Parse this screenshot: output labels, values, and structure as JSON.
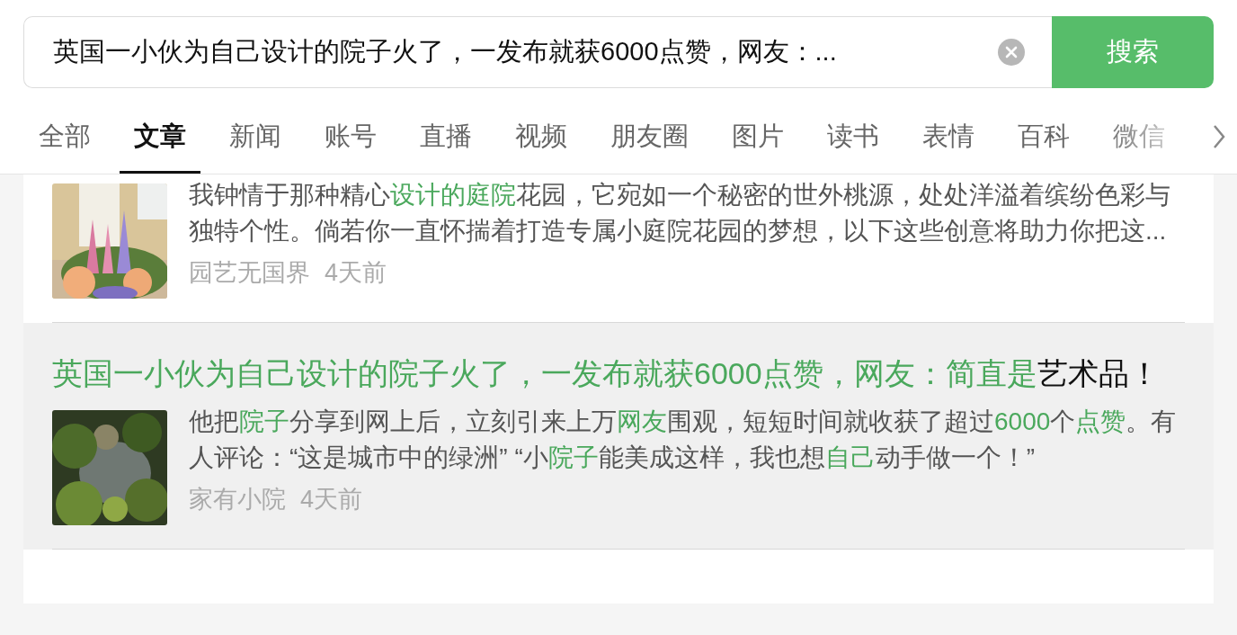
{
  "search": {
    "value": "英国一小伙为自己设计的院子火了，一发布就获6000点赞，网友：...",
    "button": "搜索"
  },
  "tabs": [
    {
      "label": "全部",
      "selected": false
    },
    {
      "label": "文章",
      "selected": true
    },
    {
      "label": "新闻",
      "selected": false
    },
    {
      "label": "账号",
      "selected": false
    },
    {
      "label": "直播",
      "selected": false
    },
    {
      "label": "视频",
      "selected": false
    },
    {
      "label": "朋友圈",
      "selected": false
    },
    {
      "label": "图片",
      "selected": false
    },
    {
      "label": "读书",
      "selected": false
    },
    {
      "label": "表情",
      "selected": false
    },
    {
      "label": "百科",
      "selected": false
    },
    {
      "label": "微信",
      "selected": false
    }
  ],
  "results": [
    {
      "selected": false,
      "summary": [
        {
          "text": "我钟情于那种精心",
          "hl": false
        },
        {
          "text": "设计的庭院",
          "hl": true
        },
        {
          "text": "花园，它宛如一个秘密的世外桃源，处处洋溢着缤纷色彩与独特个性。倘若你一直怀揣着打造专属小庭院花园的梦想，以下这些创意将助力你把这...",
          "hl": false
        }
      ],
      "source": "园艺无国界",
      "time": "4天前"
    },
    {
      "selected": true,
      "title": [
        {
          "text": "英国一小伙为自己设计的院子火了，一发布就获6000点赞，网友：简直是",
          "hl": true
        },
        {
          "text": "艺术品！",
          "hl": false
        }
      ],
      "summary": [
        {
          "text": "他把",
          "hl": false
        },
        {
          "text": "院子",
          "hl": true
        },
        {
          "text": "分享到网上后，立刻引来上万",
          "hl": false
        },
        {
          "text": "网友",
          "hl": true
        },
        {
          "text": "围观，短短时间就收获了超过",
          "hl": false
        },
        {
          "text": "6000",
          "hl": true
        },
        {
          "text": "个",
          "hl": false
        },
        {
          "text": "点赞",
          "hl": true
        },
        {
          "text": "。有人评论：“这是城市中的绿洲” “小",
          "hl": false
        },
        {
          "text": "院子",
          "hl": true
        },
        {
          "text": "能美成这样，我也想",
          "hl": false
        },
        {
          "text": "自己",
          "hl": true
        },
        {
          "text": "动手做一个！”",
          "hl": false
        }
      ],
      "source": "家有小院",
      "time": "4天前"
    }
  ]
}
